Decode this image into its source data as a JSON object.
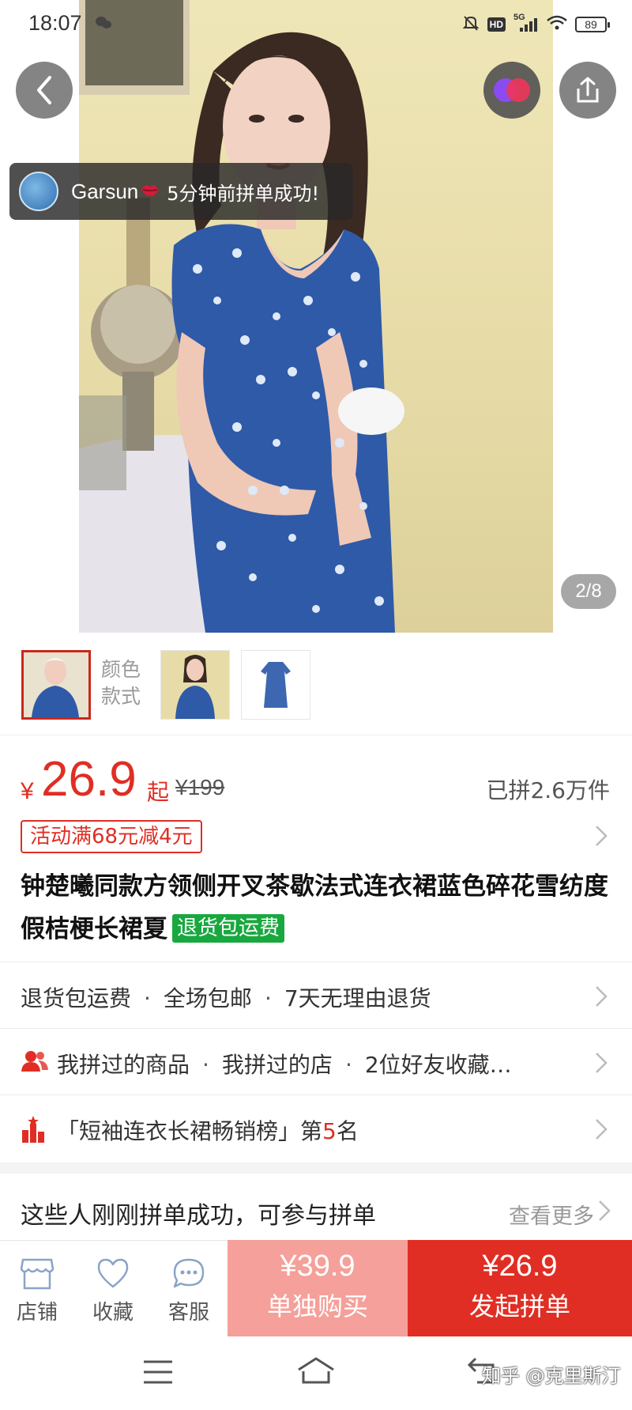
{
  "status_bar": {
    "time": "18:07",
    "network": "5G",
    "hd": "HD",
    "battery": "89"
  },
  "hero": {
    "page_counter": "2/8",
    "toast": {
      "user": "Garsun",
      "message": "5分钟前拼单成功!"
    }
  },
  "thumbs": {
    "label_line1": "颜色",
    "label_line2": "款式"
  },
  "price": {
    "currency": "¥",
    "value": "26.9",
    "suffix": "起",
    "original": "¥199",
    "sold": "已拼2.6万件"
  },
  "promo": "活动满68元减4元",
  "product": {
    "title": "钟楚曦同款方领侧开叉茶歇法式连衣裙蓝色碎花雪纺度假桔梗长裙夏",
    "tag": "退货包运费"
  },
  "services": [
    "退货包运费",
    "全场包邮",
    "7天无理由退货"
  ],
  "social": {
    "items": [
      "我拼过的商品",
      "我拼过的店",
      "2位好友收藏…"
    ]
  },
  "ranking": {
    "prefix": "「短袖连衣长裙畅销榜」第",
    "rank": "5",
    "suffix": "名"
  },
  "group_section": {
    "title": "这些人刚刚拼单成功，可参与拼单",
    "more": "查看更多"
  },
  "bottom_bar": {
    "tabs": [
      {
        "label": "店铺",
        "icon": "store-icon"
      },
      {
        "label": "收藏",
        "icon": "heart-icon"
      },
      {
        "label": "客服",
        "icon": "chat-icon"
      }
    ],
    "buy_alone": {
      "price": "¥39.9",
      "label": "单独购买"
    },
    "buy_group": {
      "price": "¥26.9",
      "label": "发起拼单"
    }
  },
  "watermark": "知乎 @克里斯汀",
  "colors": {
    "accent": "#e02e24",
    "accent_light": "#f5a09a",
    "tag_green": "#19a83f"
  }
}
